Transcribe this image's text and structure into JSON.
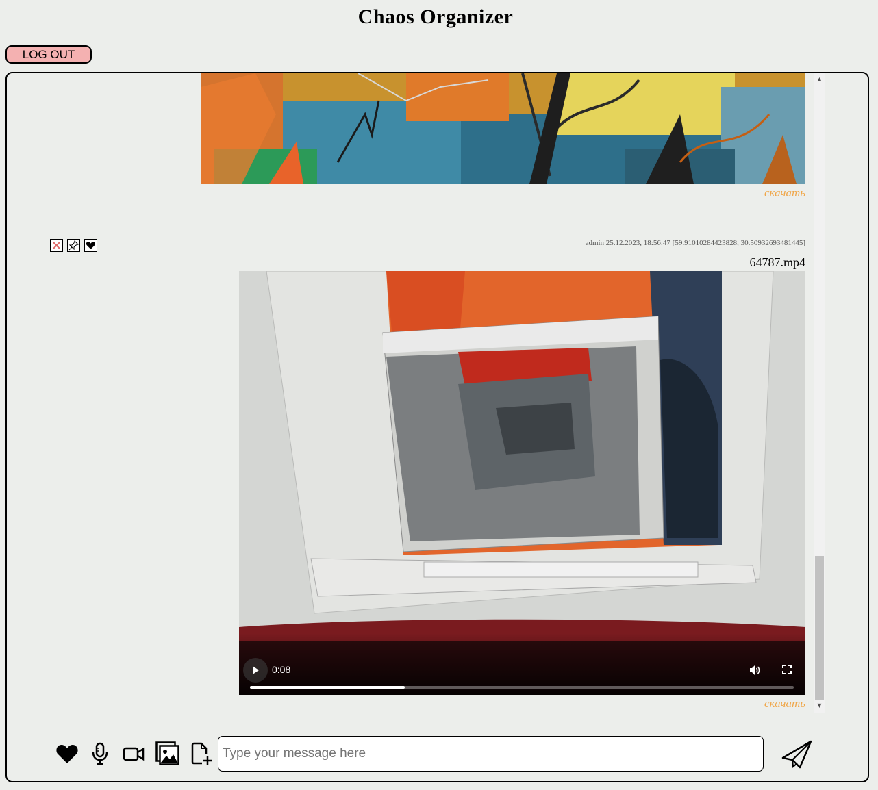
{
  "app": {
    "title": "Chaos Organizer"
  },
  "header": {
    "logout_label": "LOG OUT"
  },
  "feed": {
    "messages": [
      {
        "type": "image",
        "download_label": "скачать"
      },
      {
        "type": "video",
        "meta": "admin 25.12.2023, 18:56:47 [59.91010284423828, 30.50932693481445]",
        "file_name": "64787.mp4",
        "actions": [
          "delete-icon",
          "pin-icon",
          "heart-icon"
        ],
        "player": {
          "time": "0:08",
          "progress_fraction": 0.285
        },
        "download_label": "скачать"
      }
    ]
  },
  "composer": {
    "tools": [
      "heart-icon",
      "microphone-icon",
      "video-camera-icon",
      "image-icon",
      "file-add-icon"
    ],
    "placeholder": "Type your message here",
    "value": ""
  },
  "colors": {
    "background": "#eceeeb",
    "logout_button": "#f4b1b1",
    "download_link": "#f0a74a"
  }
}
